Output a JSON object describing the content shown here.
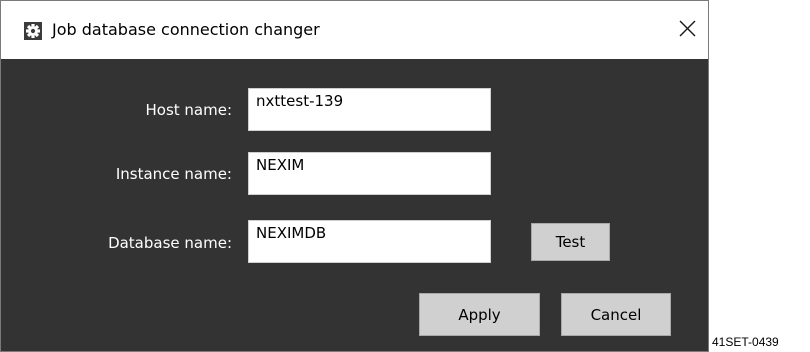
{
  "window": {
    "title": "Job database connection changer",
    "icon": "gear-icon",
    "close_glyph": "✕"
  },
  "form": {
    "host_label": "Host name:",
    "host_value": "nxttest-139",
    "instance_label": "Instance name:",
    "instance_value": "NEXIM",
    "database_label": "Database name:",
    "database_value": "NEXIMDB"
  },
  "buttons": {
    "test": "Test",
    "apply": "Apply",
    "cancel": "Cancel"
  },
  "figure_code": "41SET-0439",
  "colors": {
    "client_background": "#333333",
    "title_background": "#ffffff",
    "button_face": "#d0d0d0"
  }
}
